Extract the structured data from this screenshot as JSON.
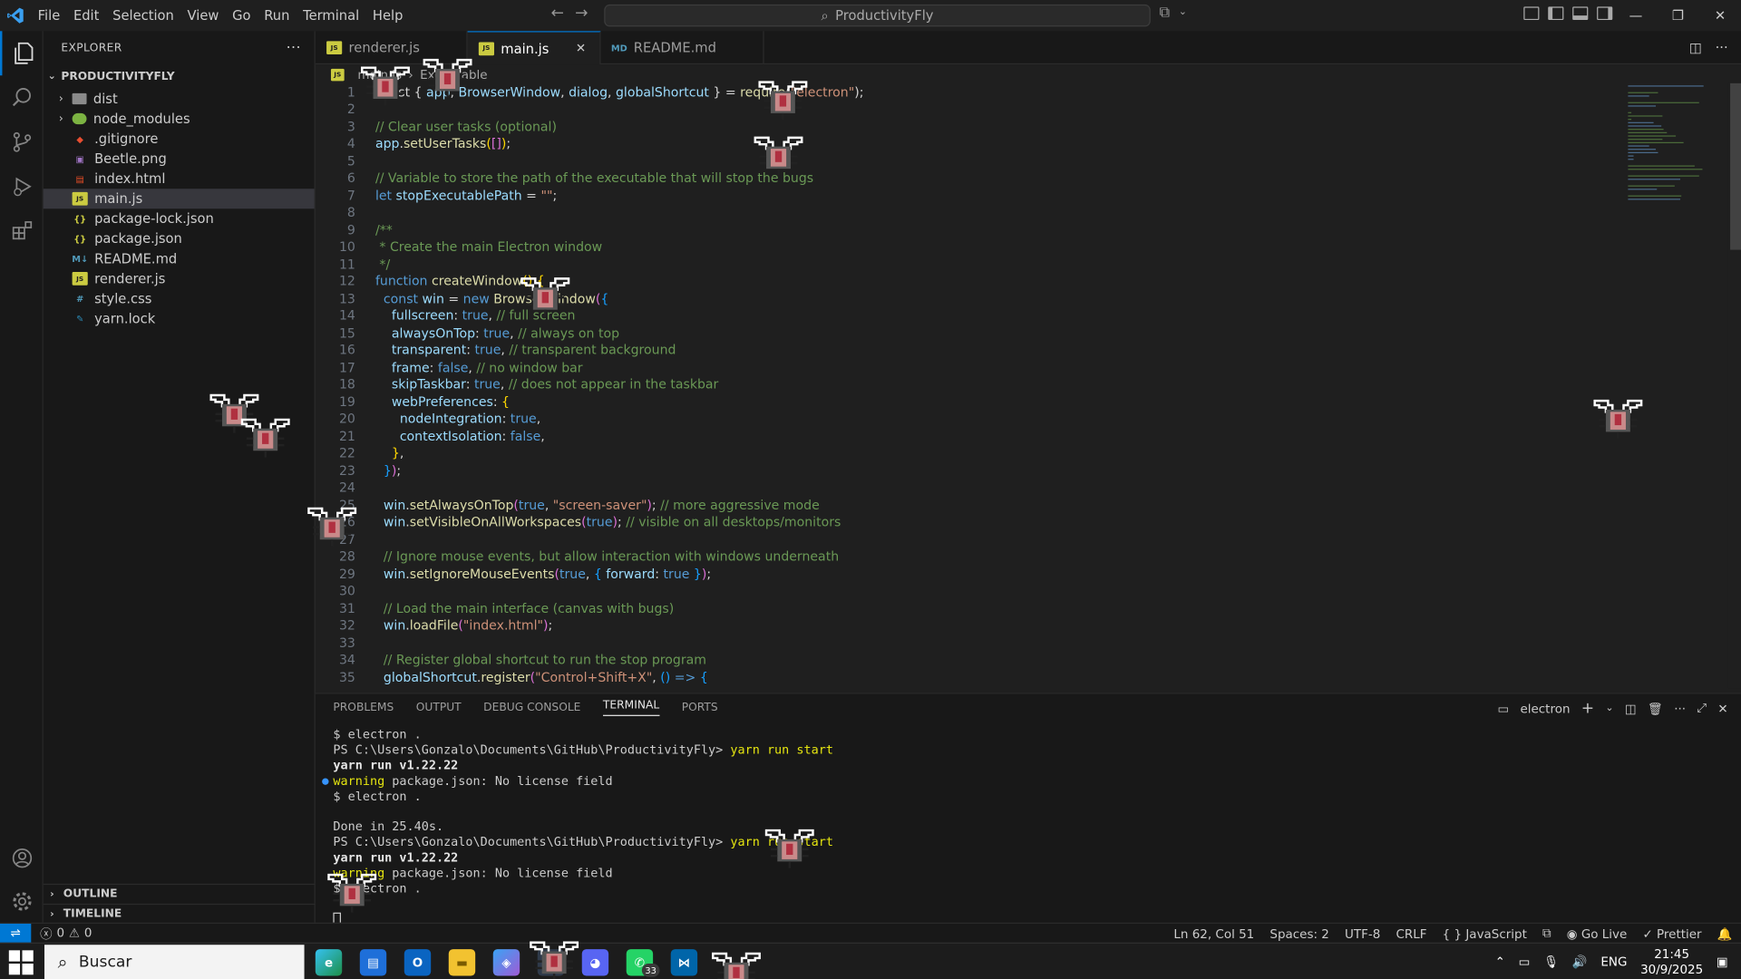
{
  "titlebar": {
    "menu": [
      "File",
      "Edit",
      "Selection",
      "View",
      "Go",
      "Run",
      "Terminal",
      "Help"
    ],
    "search_text": "ProductivityFly"
  },
  "sidebar": {
    "header": "EXPLORER",
    "project": "PRODUCTIVITYFLY",
    "items": [
      {
        "name": "dist",
        "type": "folder"
      },
      {
        "name": "node_modules",
        "type": "folder-node"
      },
      {
        "name": ".gitignore",
        "type": "git"
      },
      {
        "name": "Beetle.png",
        "type": "image"
      },
      {
        "name": "index.html",
        "type": "html"
      },
      {
        "name": "main.js",
        "type": "js",
        "selected": true
      },
      {
        "name": "package-lock.json",
        "type": "json"
      },
      {
        "name": "package.json",
        "type": "json"
      },
      {
        "name": "README.md",
        "type": "md"
      },
      {
        "name": "renderer.js",
        "type": "js"
      },
      {
        "name": "style.css",
        "type": "css"
      },
      {
        "name": "yarn.lock",
        "type": "yarn"
      }
    ],
    "outline": "OUTLINE",
    "timeline": "TIMELINE"
  },
  "tabs": [
    {
      "label": "renderer.js",
      "icon": "JS",
      "active": false
    },
    {
      "label": "main.js",
      "icon": "JS",
      "active": true
    },
    {
      "label": "README.md",
      "icon": "MD",
      "active": false
    }
  ],
  "breadcrumb": [
    "main.js",
    "Executable"
  ],
  "code_lines": [
    [
      [
        "pl",
        "const { "
      ],
      [
        "var",
        "app"
      ],
      [
        "pl",
        ", "
      ],
      [
        "var",
        "BrowserWindow"
      ],
      [
        "pl",
        ", "
      ],
      [
        "var",
        "dialog"
      ],
      [
        "pl",
        ", "
      ],
      [
        "var",
        "globalShortcut"
      ],
      [
        "pl",
        " } = "
      ],
      [
        "fn",
        "require"
      ],
      [
        "pl",
        "("
      ],
      [
        "str",
        "\"electron\""
      ],
      [
        "pl",
        ");"
      ]
    ],
    [],
    [
      [
        "cm",
        "// Clear user tasks (optional)"
      ]
    ],
    [
      [
        "var",
        "app"
      ],
      [
        "pl",
        "."
      ],
      [
        "fn",
        "setUserTasks"
      ],
      [
        "br",
        "("
      ],
      [
        "br2",
        "[]"
      ],
      [
        "br",
        ")"
      ],
      [
        "pl",
        ";"
      ]
    ],
    [],
    [
      [
        "cm",
        "// Variable to store the path of the executable that will stop the bugs"
      ]
    ],
    [
      [
        "kw",
        "let "
      ],
      [
        "var",
        "stopExecutablePath"
      ],
      [
        "pl",
        " = "
      ],
      [
        "str",
        "\"\""
      ],
      [
        "pl",
        ";"
      ]
    ],
    [],
    [
      [
        "cm",
        "/**"
      ]
    ],
    [
      [
        "cm",
        " * Create the main Electron window"
      ]
    ],
    [
      [
        "cm",
        " */"
      ]
    ],
    [
      [
        "kw",
        "function "
      ],
      [
        "fn",
        "createWindow"
      ],
      [
        "br",
        "()"
      ],
      [
        "pl",
        " "
      ],
      [
        "br",
        "{"
      ]
    ],
    [
      [
        "pl",
        "  "
      ],
      [
        "kw",
        "const "
      ],
      [
        "var",
        "win"
      ],
      [
        "pl",
        " = "
      ],
      [
        "kw",
        "new "
      ],
      [
        "fn",
        "BrowserWindow"
      ],
      [
        "br2",
        "("
      ],
      [
        "br3",
        "{"
      ]
    ],
    [
      [
        "pl",
        "    "
      ],
      [
        "var",
        "fullscreen"
      ],
      [
        "pl",
        ": "
      ],
      [
        "kw",
        "true"
      ],
      [
        "pl",
        ", "
      ],
      [
        "cm",
        "// full screen"
      ]
    ],
    [
      [
        "pl",
        "    "
      ],
      [
        "var",
        "alwaysOnTop"
      ],
      [
        "pl",
        ": "
      ],
      [
        "kw",
        "true"
      ],
      [
        "pl",
        ", "
      ],
      [
        "cm",
        "// always on top"
      ]
    ],
    [
      [
        "pl",
        "    "
      ],
      [
        "var",
        "transparent"
      ],
      [
        "pl",
        ": "
      ],
      [
        "kw",
        "true"
      ],
      [
        "pl",
        ", "
      ],
      [
        "cm",
        "// transparent background"
      ]
    ],
    [
      [
        "pl",
        "    "
      ],
      [
        "var",
        "frame"
      ],
      [
        "pl",
        ": "
      ],
      [
        "kw",
        "false"
      ],
      [
        "pl",
        ", "
      ],
      [
        "cm",
        "// no window bar"
      ]
    ],
    [
      [
        "pl",
        "    "
      ],
      [
        "var",
        "skipTaskbar"
      ],
      [
        "pl",
        ": "
      ],
      [
        "kw",
        "true"
      ],
      [
        "pl",
        ", "
      ],
      [
        "cm",
        "// does not appear in the taskbar"
      ]
    ],
    [
      [
        "pl",
        "    "
      ],
      [
        "var",
        "webPreferences"
      ],
      [
        "pl",
        ": "
      ],
      [
        "br",
        "{"
      ]
    ],
    [
      [
        "pl",
        "      "
      ],
      [
        "var",
        "nodeIntegration"
      ],
      [
        "pl",
        ": "
      ],
      [
        "kw",
        "true"
      ],
      [
        "pl",
        ","
      ]
    ],
    [
      [
        "pl",
        "      "
      ],
      [
        "var",
        "contextIsolation"
      ],
      [
        "pl",
        ": "
      ],
      [
        "kw",
        "false"
      ],
      [
        "pl",
        ","
      ]
    ],
    [
      [
        "pl",
        "    "
      ],
      [
        "br",
        "}"
      ],
      [
        "pl",
        ","
      ]
    ],
    [
      [
        "pl",
        "  "
      ],
      [
        "br3",
        "}"
      ],
      [
        "br2",
        ")"
      ],
      [
        "pl",
        ";"
      ]
    ],
    [],
    [
      [
        "pl",
        "  "
      ],
      [
        "var",
        "win"
      ],
      [
        "pl",
        "."
      ],
      [
        "fn",
        "setAlwaysOnTop"
      ],
      [
        "br2",
        "("
      ],
      [
        "kw",
        "true"
      ],
      [
        "pl",
        ", "
      ],
      [
        "str",
        "\"screen-saver\""
      ],
      [
        "br2",
        ")"
      ],
      [
        "pl",
        "; "
      ],
      [
        "cm",
        "// more aggressive mode"
      ]
    ],
    [
      [
        "pl",
        "  "
      ],
      [
        "var",
        "win"
      ],
      [
        "pl",
        "."
      ],
      [
        "fn",
        "setVisibleOnAllWorkspaces"
      ],
      [
        "br2",
        "("
      ],
      [
        "kw",
        "true"
      ],
      [
        "br2",
        ")"
      ],
      [
        "pl",
        "; "
      ],
      [
        "cm",
        "// visible on all desktops/monitors"
      ]
    ],
    [],
    [
      [
        "pl",
        "  "
      ],
      [
        "cm",
        "// Ignore mouse events, but allow interaction with windows underneath"
      ]
    ],
    [
      [
        "pl",
        "  "
      ],
      [
        "var",
        "win"
      ],
      [
        "pl",
        "."
      ],
      [
        "fn",
        "setIgnoreMouseEvents"
      ],
      [
        "br2",
        "("
      ],
      [
        "kw",
        "true"
      ],
      [
        "pl",
        ", "
      ],
      [
        "br3",
        "{ "
      ],
      [
        "var",
        "forward"
      ],
      [
        "pl",
        ": "
      ],
      [
        "kw",
        "true"
      ],
      [
        "br3",
        " }"
      ],
      [
        "br2",
        ")"
      ],
      [
        "pl",
        ";"
      ]
    ],
    [],
    [
      [
        "pl",
        "  "
      ],
      [
        "cm",
        "// Load the main interface (canvas with bugs)"
      ]
    ],
    [
      [
        "pl",
        "  "
      ],
      [
        "var",
        "win"
      ],
      [
        "pl",
        "."
      ],
      [
        "fn",
        "loadFile"
      ],
      [
        "br2",
        "("
      ],
      [
        "str",
        "\"index.html\""
      ],
      [
        "br2",
        ")"
      ],
      [
        "pl",
        ";"
      ]
    ],
    [],
    [
      [
        "pl",
        "  "
      ],
      [
        "cm",
        "// Register global shortcut to run the stop program"
      ]
    ],
    [
      [
        "pl",
        "  "
      ],
      [
        "var",
        "globalShortcut"
      ],
      [
        "pl",
        "."
      ],
      [
        "fn",
        "register"
      ],
      [
        "br2",
        "("
      ],
      [
        "str",
        "\"Control+Shift+X\""
      ],
      [
        "pl",
        ", "
      ],
      [
        "br3",
        "()"
      ],
      [
        "pl",
        " "
      ],
      [
        "kw",
        "=>"
      ],
      [
        "pl",
        " "
      ],
      [
        "br3",
        "{"
      ]
    ]
  ],
  "panel": {
    "tabs": [
      "PROBLEMS",
      "OUTPUT",
      "DEBUG CONSOLE",
      "TERMINAL",
      "PORTS"
    ],
    "active_tab": "TERMINAL",
    "terminal_name": "electron",
    "lines": [
      {
        "parts": [
          [
            "n",
            "$ electron ."
          ]
        ]
      },
      {
        "parts": [
          [
            "n",
            "PS C:\\Users\\Gonzalo\\Documents\\GitHub\\ProductivityFly> "
          ],
          [
            "y",
            "yarn run start"
          ]
        ]
      },
      {
        "parts": [
          [
            "b",
            "yarn run v1.22.22"
          ]
        ]
      },
      {
        "parts": [
          [
            "y",
            "warning"
          ],
          [
            "n",
            " package.json: No license field"
          ]
        ],
        "dot": true
      },
      {
        "parts": [
          [
            "n",
            "$ electron ."
          ]
        ]
      },
      {
        "parts": [
          [
            "n",
            ""
          ]
        ]
      },
      {
        "parts": [
          [
            "n",
            "Done in 25.40s."
          ]
        ]
      },
      {
        "parts": [
          [
            "n",
            "PS C:\\Users\\Gonzalo\\Documents\\GitHub\\ProductivityFly> "
          ],
          [
            "y",
            "yarn run start"
          ]
        ]
      },
      {
        "parts": [
          [
            "b",
            "yarn run v1.22.22"
          ]
        ]
      },
      {
        "parts": [
          [
            "y",
            "warning"
          ],
          [
            "n",
            " package.json: No license field"
          ]
        ]
      },
      {
        "parts": [
          [
            "n",
            "$ electron ."
          ]
        ]
      },
      {
        "parts": [
          [
            "n",
            ""
          ]
        ]
      }
    ]
  },
  "status": {
    "errors": "0",
    "warnings": "0",
    "position": "Ln 62, Col 51",
    "spaces": "Spaces: 2",
    "encoding": "UTF-8",
    "eol": "CRLF",
    "language": "JavaScript",
    "golive": "Go Live",
    "prettier": "Prettier"
  },
  "taskbar": {
    "search_placeholder": "Buscar",
    "whatsapp_badge": "33",
    "lang": "ENG",
    "time": "21:45",
    "date": "30/9/2025"
  }
}
